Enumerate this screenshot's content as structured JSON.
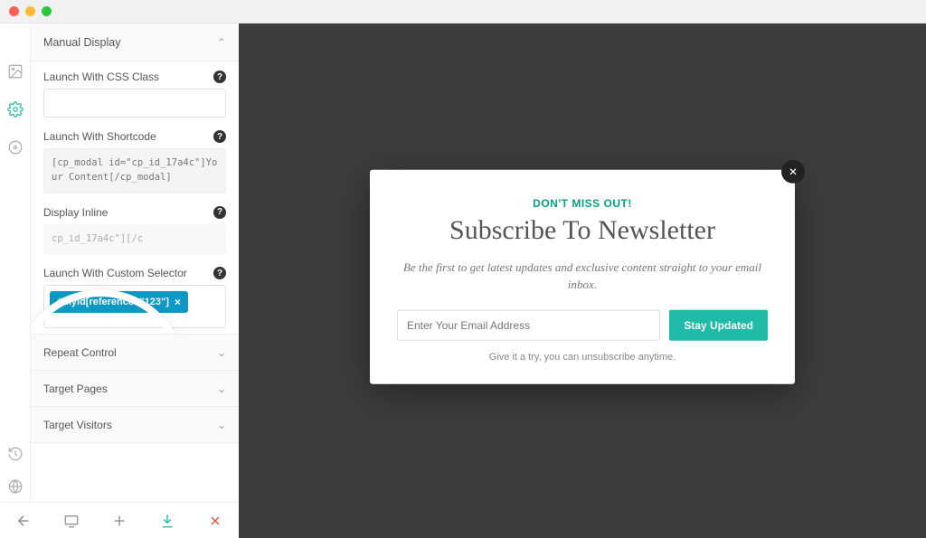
{
  "sidebar": {
    "manualDisplay": "Manual Display",
    "launchCssClass": "Launch With CSS Class",
    "launchShortcode": "Launch With Shortcode",
    "shortcodeExample": "[cp_modal id=\"cp_id_17a4c\"]Your Content[/cp_modal]",
    "displayInline": "Display Inline",
    "inlineExample": "cp_id_17a4c\"][/c",
    "launchCustomSelector": "Launch With Custom Selector",
    "customSelectorTag": "#myid[reference=\"123\"]",
    "repeatControl": "Repeat Control",
    "targetPages": "Target Pages",
    "targetVisitors": "Target Visitors"
  },
  "modal": {
    "kicker": "DON'T MISS OUT!",
    "title": "Subscribe To Newsletter",
    "subtitle": "Be the first to get latest updates and exclusive content straight to your email inbox.",
    "emailPlaceholder": "Enter Your Email Address",
    "cta": "Stay Updated",
    "footnote": "Give it a try, you can unsubscribe anytime."
  }
}
